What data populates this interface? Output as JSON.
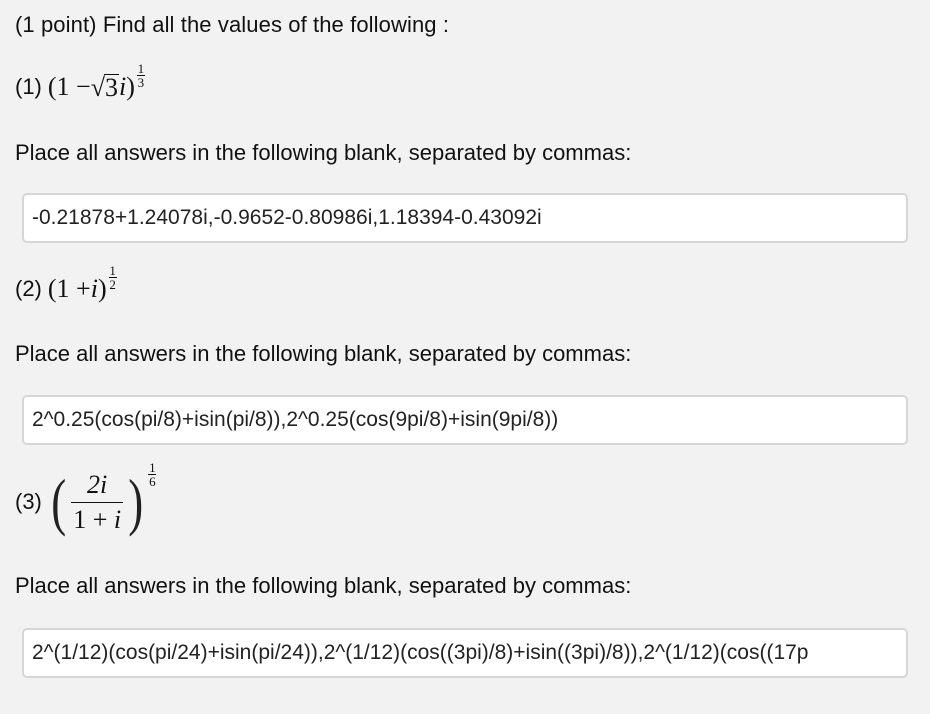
{
  "intro": "(1 point) Find all the values of the following :",
  "instruction": "Place all answers in the following blank, separated by commas:",
  "problems": [
    {
      "label": "(1)",
      "expr": {
        "open": "(1 − ",
        "radical": "√",
        "radicand": "3",
        "var": "i",
        "close": ")",
        "exp_num": "1",
        "exp_den": "3"
      },
      "answer": "-0.21878+1.24078i,-0.9652-0.80986i,1.18394-0.43092i"
    },
    {
      "label": "(2)",
      "expr": {
        "open": "(1 + ",
        "var": "i",
        "close": ")",
        "exp_num": "1",
        "exp_den": "2"
      },
      "answer": "2^0.25(cos(pi/8)+isin(pi/8)),2^0.25(cos(9pi/8)+isin(9pi/8))"
    },
    {
      "label": "(3)",
      "expr": {
        "paren_open": "(",
        "num": "2i",
        "den_lead": "1 + ",
        "den_var": "i",
        "paren_close": ")",
        "exp_num": "1",
        "exp_den": "6"
      },
      "answer": "2^(1/12)(cos(pi/24)+isin(pi/24)),2^(1/12)(cos((3pi)/8)+isin((3pi)/8)),2^(1/12)(cos((17p"
    }
  ]
}
